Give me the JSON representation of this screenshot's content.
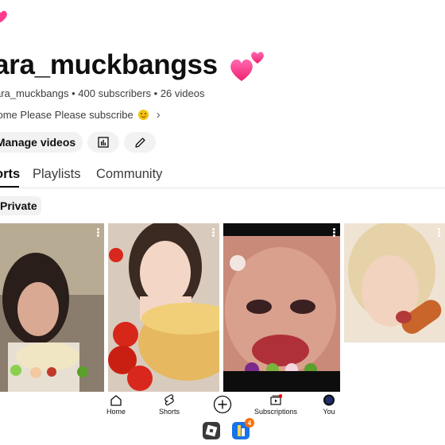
{
  "channel": {
    "title": "ara_muckbangss",
    "meta": "ara_muckbangs • 400 subscribers • 26 videos",
    "description": "come Please Please subscribe"
  },
  "actions": {
    "manage_videos": "Manage videos"
  },
  "tabs": [
    {
      "label": "orts",
      "selected": true
    },
    {
      "label": "Playlists",
      "selected": false
    },
    {
      "label": "Community",
      "selected": false
    }
  ],
  "filter_chip": "Private",
  "bottom_nav": [
    {
      "label": "Home",
      "icon": "home-icon"
    },
    {
      "label": "Shorts",
      "icon": "shorts-icon"
    },
    {
      "label": "",
      "icon": "create-icon"
    },
    {
      "label": "Subscriptions",
      "icon": "subscriptions-icon"
    },
    {
      "label": "You",
      "icon": "avatar-icon"
    }
  ],
  "taskbar": {
    "apps": [
      "roblox-app-icon",
      "blue-app-icon"
    ],
    "badge_count": "4"
  },
  "colors": {
    "heart_pink": "#ff3b8d",
    "chip_bg": "#f2f2f2",
    "text": "#0f0f0f",
    "badge": "#ff6d00"
  }
}
